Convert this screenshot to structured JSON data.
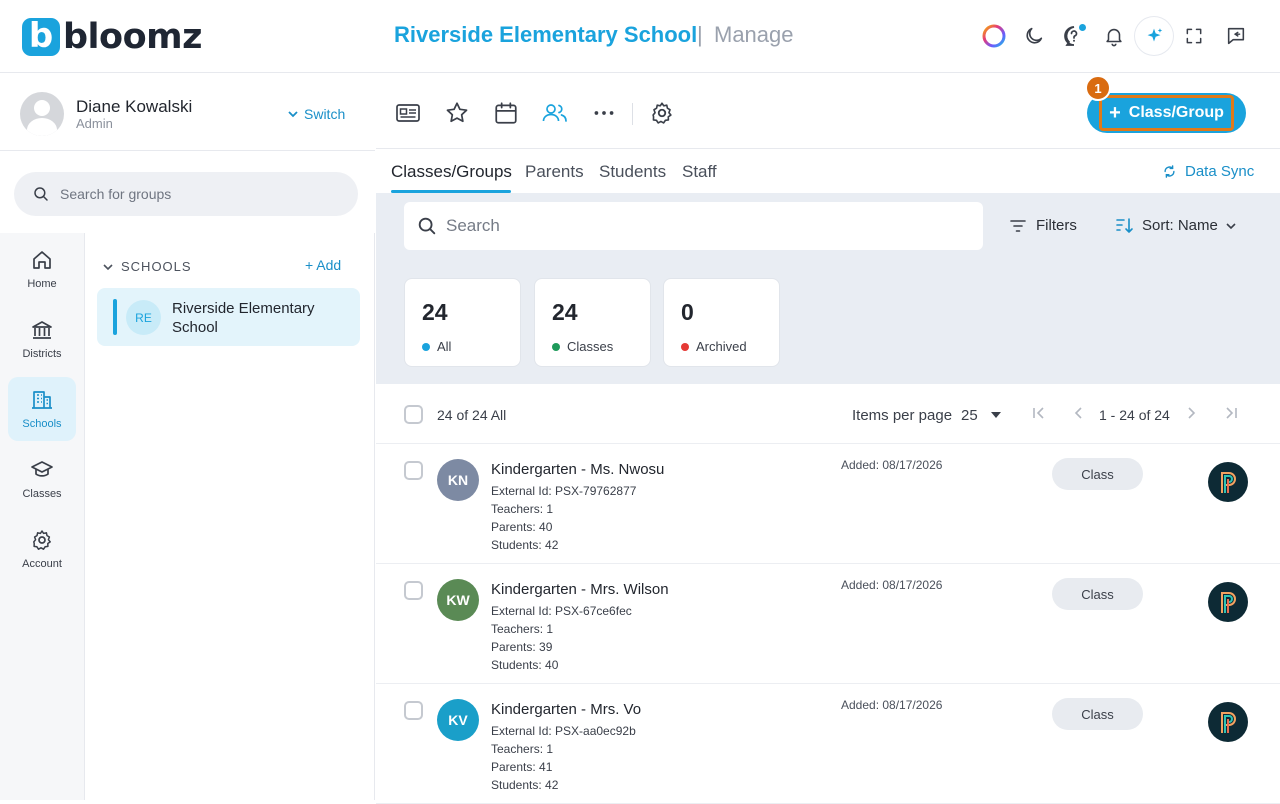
{
  "app": {
    "logo_letter": "b",
    "logo_text": "bloomz",
    "school_title": "Riverside Elementary School",
    "separator": "|",
    "section": "Manage"
  },
  "user": {
    "name": "Diane Kowalski",
    "role": "Admin",
    "switch_label": "Switch"
  },
  "sidebar": {
    "search_placeholder": "Search for groups",
    "nav": [
      {
        "label": "Home",
        "icon": "home-icon"
      },
      {
        "label": "Districts",
        "icon": "district-icon"
      },
      {
        "label": "Schools",
        "icon": "school-icon",
        "active": true
      },
      {
        "label": "Classes",
        "icon": "graduation-cap-icon"
      },
      {
        "label": "Account",
        "icon": "gear-icon"
      }
    ],
    "schools_header": "SCHOOLS",
    "add_label": "+ Add",
    "school": {
      "initials": "RE",
      "name": "Riverside Elementary School"
    }
  },
  "toolbar": {
    "add_button_label": "Class/Group",
    "step_number": "1"
  },
  "tabs": [
    {
      "label": "Classes/Groups",
      "active": true
    },
    {
      "label": "Parents"
    },
    {
      "label": "Students"
    },
    {
      "label": "Staff"
    }
  ],
  "data_sync_label": "Data Sync",
  "search_placeholder": "Search",
  "filters_label": "Filters",
  "sort_label": "Sort: Name",
  "stats": [
    {
      "value": "24",
      "label": "All",
      "color": "#1aa3dd"
    },
    {
      "value": "24",
      "label": "Classes",
      "color": "#1e9a5a"
    },
    {
      "value": "0",
      "label": "Archived",
      "color": "#e53935"
    }
  ],
  "list": {
    "count_label": "24 of 24 All",
    "items_per_page_label": "Items per page",
    "items_per_page": "25",
    "page_range": "1 - 24 of 24"
  },
  "rows": [
    {
      "initials": "KN",
      "avatar_color": "#7d8aa3",
      "name": "Kindergarten - Ms. Nwosu",
      "external_id": "External Id: PSX-79762877",
      "teachers": "Teachers: 1",
      "parents": "Parents: 40",
      "students": "Students: 42",
      "added": "Added: 08/17/2026",
      "type": "Class"
    },
    {
      "initials": "KW",
      "avatar_color": "#5a8a55",
      "name": "Kindergarten - Mrs. Wilson",
      "external_id": "External Id: PSX-67ce6fec",
      "teachers": "Teachers: 1",
      "parents": "Parents: 39",
      "students": "Students: 40",
      "added": "Added: 08/17/2026",
      "type": "Class"
    },
    {
      "initials": "KV",
      "avatar_color": "#1a9fc9",
      "name": "Kindergarten - Mrs. Vo",
      "external_id": "External Id: PSX-aa0ec92b",
      "teachers": "Teachers: 1",
      "parents": "Parents: 41",
      "students": "Students: 42",
      "added": "Added: 08/17/2026",
      "type": "Class"
    }
  ]
}
